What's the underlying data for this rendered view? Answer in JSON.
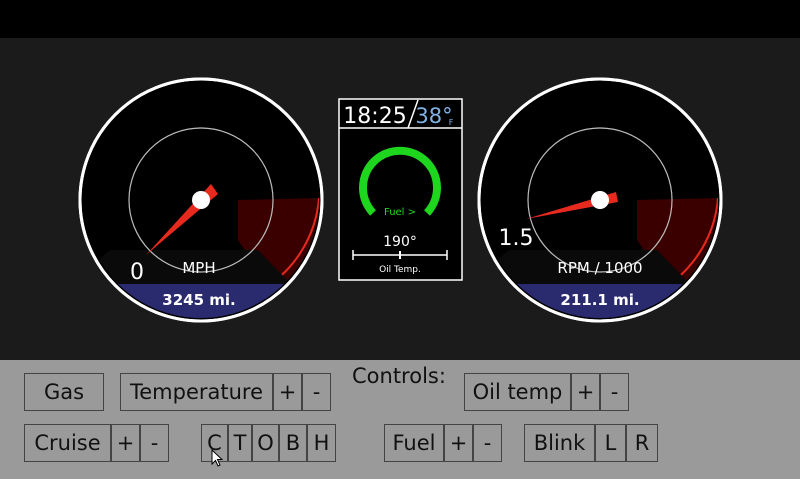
{
  "speedometer": {
    "value": "0",
    "unit_label": "MPH",
    "odometer": "3245 mi."
  },
  "tachometer": {
    "value": "1.5",
    "unit_label": "RPM / 1000",
    "trip": "211.1 mi."
  },
  "center_panel": {
    "clock": "18:25",
    "outside_temp": "38°",
    "outside_temp_unit": "F",
    "fuel_label": "Fuel >",
    "oil_temp_value": "190°",
    "oil_temp_label": "Oil Temp."
  },
  "controls": {
    "title": "Controls:",
    "gas": "Gas",
    "temperature": "Temperature",
    "temperature_plus": "+",
    "temperature_minus": "-",
    "oil_temp": "Oil temp",
    "oil_temp_plus": "+",
    "oil_temp_minus": "-",
    "cruise": "Cruise",
    "cruise_plus": "+",
    "cruise_minus": "-",
    "gear_c": "C",
    "gear_t": "T",
    "gear_o": "O",
    "gear_b": "B",
    "gear_h": "H",
    "fuel": "Fuel",
    "fuel_plus": "+",
    "fuel_minus": "-",
    "blink": "Blink",
    "blink_l": "L",
    "blink_r": "R"
  },
  "colors": {
    "needle": "#e82a1e",
    "redline": "#3a0000",
    "fuel_arc": "#1ed61e",
    "odo_band": "#2a2a6e",
    "dash_bg": "#1b1b1b",
    "controls_bg": "#9a9a9a"
  }
}
